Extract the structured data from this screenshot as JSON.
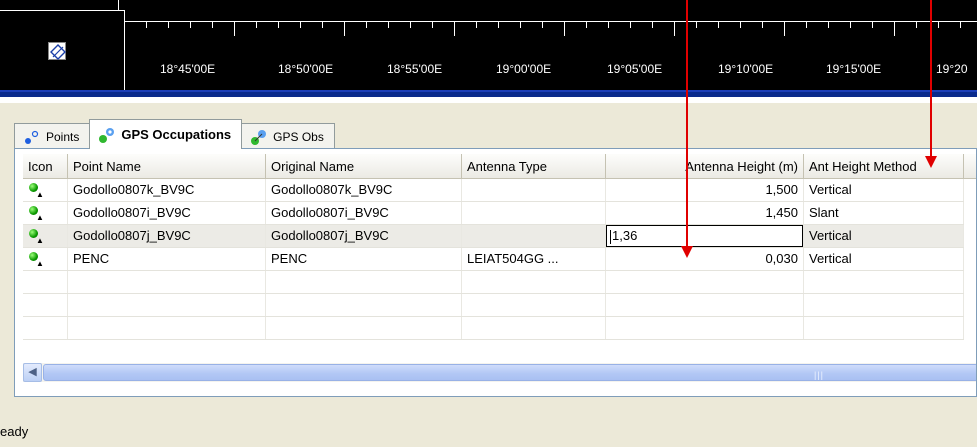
{
  "ruler": {
    "labels": [
      "18°45'00E",
      "18°50'00E",
      "18°55'00E",
      "19°00'00E",
      "19°05'00E",
      "19°10'00E",
      "19°15'00E",
      "19°20"
    ]
  },
  "tabs": [
    {
      "label": "Points",
      "icon": "points-icon",
      "active": false
    },
    {
      "label": "GPS Occupations",
      "icon": "gps-occupations-icon",
      "active": true
    },
    {
      "label": "GPS Obs",
      "icon": "gps-obs-icon",
      "active": false
    }
  ],
  "grid": {
    "columns": [
      "Icon",
      "Point Name",
      "Original Name",
      "Antenna Type",
      "Antenna Height (m)",
      "Ant Height Method"
    ],
    "rows": [
      {
        "icon": "gps-occupation-icon",
        "point_name": "Godollo0807k_BV9C",
        "original_name": "Godollo0807k_BV9C",
        "antenna_type": "",
        "antenna_height": "1,500",
        "method": "Vertical"
      },
      {
        "icon": "gps-occupation-icon",
        "point_name": "Godollo0807i_BV9C",
        "original_name": "Godollo0807i_BV9C",
        "antenna_type": "",
        "antenna_height": "1,450",
        "method": "Slant"
      },
      {
        "icon": "gps-occupation-icon",
        "point_name": "Godollo0807j_BV9C",
        "original_name": "Godollo0807j_BV9C",
        "antenna_type": "",
        "antenna_height": "1,36",
        "method": "Vertical"
      },
      {
        "icon": "gps-occupation-icon",
        "point_name": "PENC",
        "original_name": "PENC",
        "antenna_type": "LEIAT504GG ...",
        "antenna_height": "0,030",
        "method": "Vertical"
      }
    ],
    "editing_cell": {
      "row": 2,
      "column": "antenna_height"
    }
  },
  "status": {
    "text": "eady"
  },
  "colors": {
    "annotation_arrow": "#e00000",
    "selected_row": "#ecebe6",
    "ruler_bg": "#000000",
    "blue_bar": "#0a2a8c"
  }
}
